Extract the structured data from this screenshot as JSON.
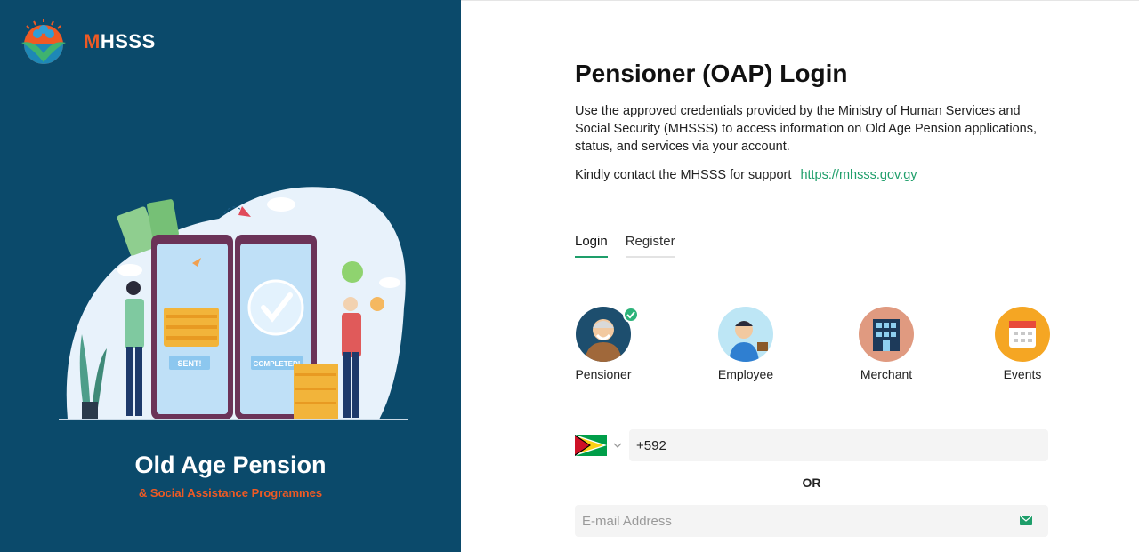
{
  "brand": {
    "logo_m": "M",
    "logo_rest": "HSSS"
  },
  "hero": {
    "title": "Old Age Pension",
    "subtitle": "& Social Assistance Programmes"
  },
  "illustration": {
    "phone1_badge": "SENT!",
    "phone2_badge": "COMPLETED!"
  },
  "login": {
    "title": "Pensioner (OAP) Login",
    "description": "Use the approved credentials provided by the Ministry of Human Services and Social Security (MHSSS) to access information on Old Age Pension applications, status, and services via your account.",
    "support_text": "Kindly contact the MHSSS for support",
    "support_link": "https://mhsss.gov.gy"
  },
  "tabs": [
    {
      "label": "Login",
      "active": true
    },
    {
      "label": "Register",
      "active": false
    }
  ],
  "roles": [
    {
      "label": "Pensioner",
      "selected": true,
      "icon": "pensioner-avatar-icon"
    },
    {
      "label": "Employee",
      "selected": false,
      "icon": "employee-avatar-icon"
    },
    {
      "label": "Merchant",
      "selected": false,
      "icon": "merchant-building-icon"
    },
    {
      "label": "Events",
      "selected": false,
      "icon": "calendar-icon"
    }
  ],
  "form": {
    "phone_value": "+592",
    "country_flag": "guyana-flag-icon",
    "or_label": "OR",
    "email_placeholder": "E-mail Address"
  },
  "colors": {
    "panel": "#0b4a6b",
    "accent": "#1e9e6a",
    "brand_orange": "#ef5a24"
  }
}
